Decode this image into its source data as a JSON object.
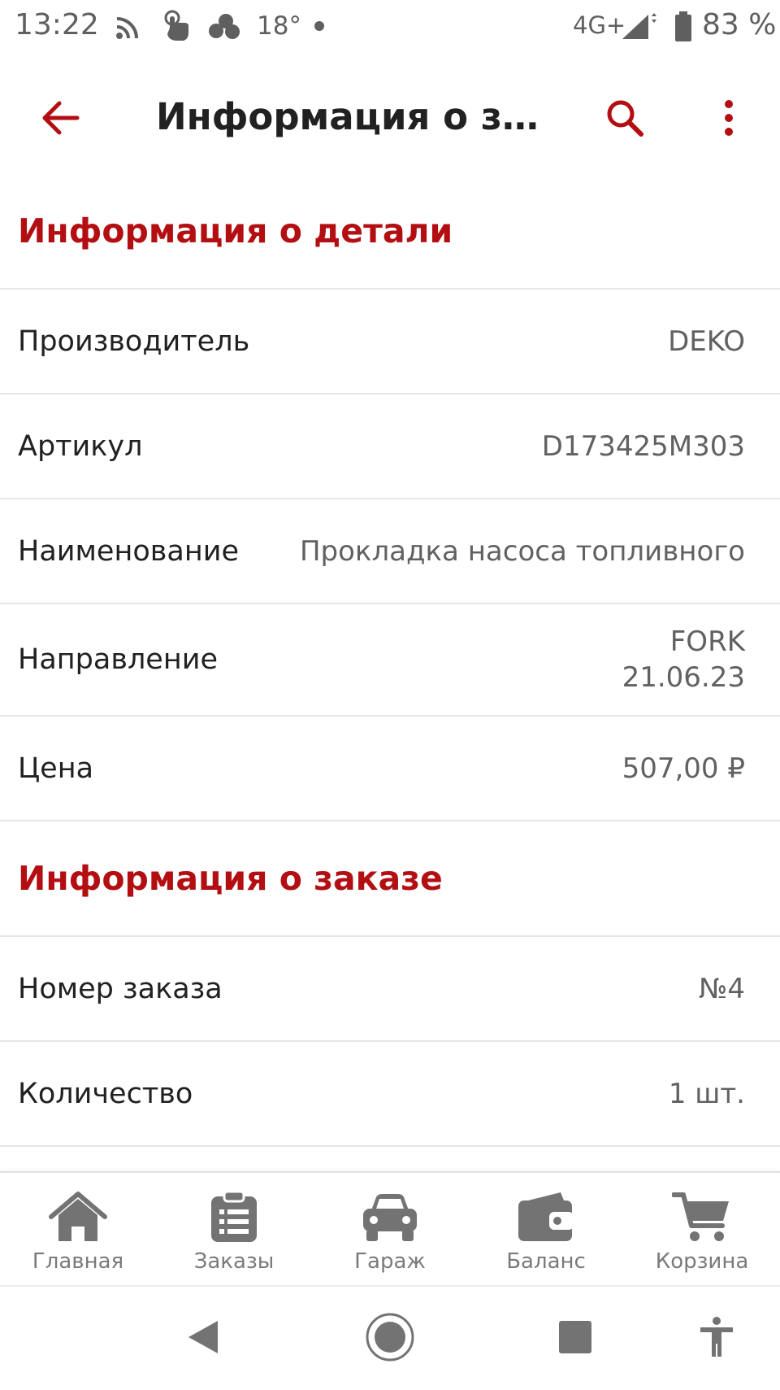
{
  "status_bar": {
    "time": "13:22",
    "temperature": "18°",
    "network": "4G+",
    "battery": "83 %",
    "icons": [
      "cast-icon",
      "touch-icon",
      "weather-cloud-icon",
      "notification-dot-icon",
      "signal-icon",
      "battery-icon"
    ]
  },
  "app_bar": {
    "title": "Информация о заказе",
    "back_icon": "arrow-back-icon",
    "search_icon": "search-icon",
    "menu_icon": "more-vert-icon"
  },
  "part_section": {
    "header": "Информация о детали",
    "rows": [
      {
        "label": "Производитель",
        "value": "DEKO"
      },
      {
        "label": "Артикул",
        "value": "D173425M303"
      },
      {
        "label": "Наименование",
        "value": "Прокладка насоса топливного"
      },
      {
        "label": "Направление",
        "value_lines": [
          "FORK",
          "21.06.23"
        ]
      },
      {
        "label": "Цена",
        "value": "507,00 ₽"
      }
    ]
  },
  "order_section": {
    "header": "Информация о заказе",
    "rows": [
      {
        "label": "Номер заказа",
        "value": "№4"
      },
      {
        "label": "Количество",
        "value": "1 шт."
      }
    ]
  },
  "bottom_nav": {
    "items": [
      {
        "label": "Главная",
        "icon": "home-icon"
      },
      {
        "label": "Заказы",
        "icon": "orders-list-icon"
      },
      {
        "label": "Гараж",
        "icon": "car-icon"
      },
      {
        "label": "Баланс",
        "icon": "wallet-icon"
      },
      {
        "label": "Корзина",
        "icon": "cart-icon"
      }
    ]
  },
  "system_nav": {
    "icons": [
      "system-back-icon",
      "system-home-icon",
      "system-recents-icon",
      "accessibility-icon"
    ]
  },
  "colors": {
    "accent": "#b30f12",
    "text_primary": "#212121",
    "text_secondary": "#616161",
    "nav_icon": "#737373",
    "divider": "#e6e6e6"
  }
}
